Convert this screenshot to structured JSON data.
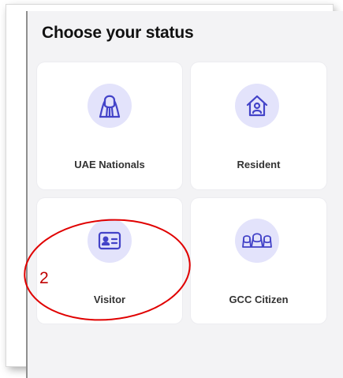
{
  "header": {
    "title": "Choose your status"
  },
  "options": [
    {
      "label": "UAE Nationals",
      "icon": "uae-national-person-icon"
    },
    {
      "label": "Resident",
      "icon": "house-person-icon"
    },
    {
      "label": "Visitor",
      "icon": "id-card-icon"
    },
    {
      "label": "GCC Citizen",
      "icon": "gcc-group-icon"
    }
  ],
  "annotation": {
    "number": "2",
    "color": "#e00000"
  },
  "colors": {
    "icon_bg": "#e3e3fb",
    "icon_stroke": "#4343c8",
    "panel_bg": "#f3f3f5"
  }
}
